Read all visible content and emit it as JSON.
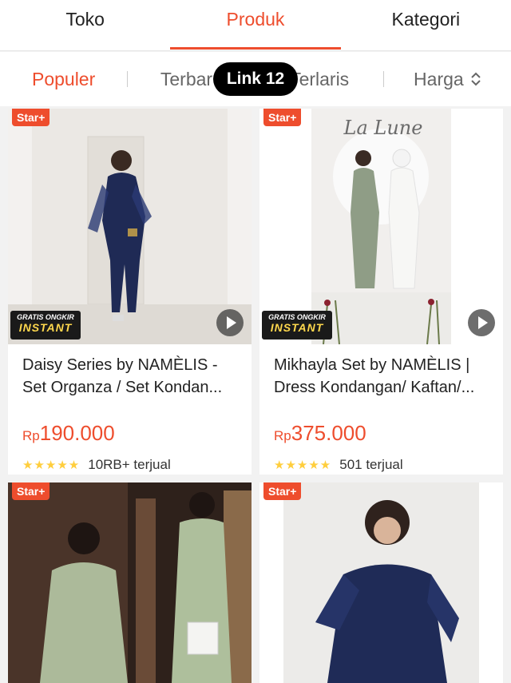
{
  "top_tabs": [
    {
      "label": "Toko"
    },
    {
      "label": "Produk"
    },
    {
      "label": "Kategori"
    }
  ],
  "sort": {
    "populer": "Populer",
    "terbaru": "Terbaru",
    "terlaris": "Terlaris",
    "harga": "Harga"
  },
  "link_pill": "Link 12",
  "products": [
    {
      "badge": "Star+",
      "gratis_line1": "GRATIS ONGKIR",
      "gratis_line2": "INSTANT",
      "title": "Daisy Series by NAMÈLIS - Set Organza / Set Kondan...",
      "currency": "Rp",
      "price": "190.000",
      "rating": 4.5,
      "sold": "10RB+ terjual"
    },
    {
      "badge": "Star+",
      "image_text": "La Lune",
      "gratis_line1": "GRATIS ONGKIR",
      "gratis_line2": "INSTANT",
      "title": "Mikhayla Set by NAMÈLIS | Dress Kondangan/ Kaftan/...",
      "currency": "Rp",
      "price": "375.000",
      "rating": 4.5,
      "sold": "501 terjual"
    },
    {
      "badge": "Star+"
    },
    {
      "badge": "Star+"
    }
  ],
  "colors": {
    "accent": "#ee4d2d",
    "star": "#ffce3d"
  }
}
